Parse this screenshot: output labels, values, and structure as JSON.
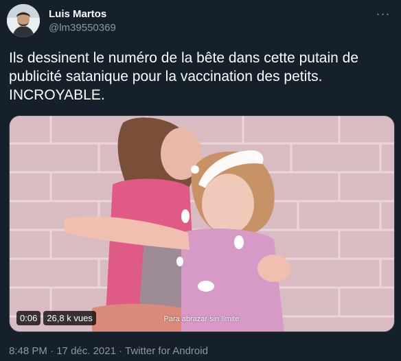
{
  "author": {
    "name": "Luis Martos",
    "handle": "@lm39550369"
  },
  "menu": {
    "icon": "more-dots-icon",
    "glyph": "···"
  },
  "tweet": {
    "text": "Ils dessinent le numéro de la bête dans cette putain de\npublicité satanique pour la vaccination des petits.\nINCROYABLE."
  },
  "media": {
    "subtitle": "Para abrazar sin límite.",
    "duration": "0:06",
    "views": "26,8 k vues"
  },
  "meta": {
    "time": "8:48 PM",
    "separator1": " · ",
    "date": "17 déc. 2021",
    "separator2": " · ",
    "source": "Twitter for Android"
  },
  "colors": {
    "background": "#15202b",
    "secondary_text": "#8b98a5",
    "border": "#38444d"
  }
}
